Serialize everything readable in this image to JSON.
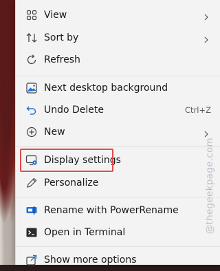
{
  "menu": {
    "items": [
      {
        "id": "view",
        "label": "View",
        "icon": "grid-icon",
        "submenu": true
      },
      {
        "id": "sort-by",
        "label": "Sort by",
        "icon": "sort-arrows-icon",
        "submenu": true
      },
      {
        "id": "refresh",
        "label": "Refresh",
        "icon": "refresh-icon"
      },
      {
        "id": "next-desktop-background",
        "label": "Next desktop background",
        "icon": "image-next-icon"
      },
      {
        "id": "undo-delete",
        "label": "Undo Delete",
        "icon": "undo-icon",
        "shortcut": "Ctrl+Z"
      },
      {
        "id": "new",
        "label": "New",
        "icon": "plus-circle-icon",
        "submenu": true
      },
      {
        "id": "display-settings",
        "label": "Display settings",
        "icon": "display-settings-icon",
        "highlighted": true
      },
      {
        "id": "personalize",
        "label": "Personalize",
        "icon": "pen-icon"
      },
      {
        "id": "rename-with-powerrename",
        "label": "Rename with PowerRename",
        "icon": "powerrename-icon"
      },
      {
        "id": "open-in-terminal",
        "label": "Open in Terminal",
        "icon": "terminal-icon"
      },
      {
        "id": "show-more-options",
        "label": "Show more options",
        "icon": "share-icon"
      }
    ]
  },
  "watermark": "@thegeekpage.com",
  "colors": {
    "highlight_border": "#e54a4a",
    "accent_blue": "#1f6fd6",
    "menu_background": "#f3f3f3"
  }
}
